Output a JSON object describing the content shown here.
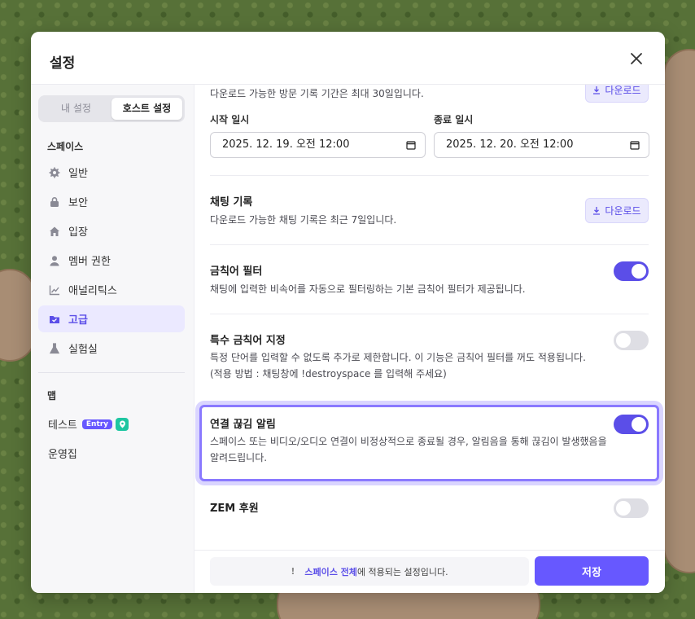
{
  "modal": {
    "title": "설정"
  },
  "sidebar": {
    "tabs": [
      {
        "label": "내 설정"
      },
      {
        "label": "호스트 설정"
      }
    ],
    "space_section": "스페이스",
    "items": [
      {
        "label": "일반",
        "icon": "gear-icon"
      },
      {
        "label": "보안",
        "icon": "lock-icon"
      },
      {
        "label": "입장",
        "icon": "home-icon"
      },
      {
        "label": "멤버 권한",
        "icon": "person-icon"
      },
      {
        "label": "애널리틱스",
        "icon": "chart-icon"
      },
      {
        "label": "고급",
        "icon": "folder-icon",
        "active": true
      },
      {
        "label": "실험실",
        "icon": "flask-icon"
      }
    ],
    "map_section": "맵",
    "maps": [
      {
        "label": "테스트",
        "badge": "Entry"
      },
      {
        "label": "운영집"
      }
    ]
  },
  "visit_log": {
    "desc": "다운로드 가능한 방문 기록 기간은 최대 30일입니다.",
    "download_label": "다운로드",
    "start_label": "시작 일시",
    "start_value": "2025. 12. 19. 오전 12:00",
    "end_label": "종료 일시",
    "end_value": "2025. 12. 20. 오전 12:00"
  },
  "chat_log": {
    "title": "채팅 기록",
    "desc": "다운로드 가능한 채팅 기록은 최근 7일입니다.",
    "download_label": "다운로드"
  },
  "settings": [
    {
      "title": "금칙어 필터",
      "desc": [
        "채팅에 입력한 비속어를 자동으로 필터링하는 기본 금칙어 필터가 제공됩니다."
      ],
      "enabled": true
    },
    {
      "title": "특수 금칙어 지정",
      "desc": [
        "특정 단어를 입력할 수 없도록 추가로 제한합니다. 이 기능은 금칙어 필터를 꺼도 적용됩니다.",
        "(적용 방법 : 채팅창에 !destroyspace 를 입력해 주세요)"
      ],
      "enabled": false
    },
    {
      "title": "연결 끊김 알림",
      "desc": [
        "스페이스 또는 비디오/오디오 연결이 비정상적으로 종료될 경우, 알림음을 통해 끊김이 발생했음을",
        "알려드립니다."
      ],
      "enabled": true
    },
    {
      "title": "ZEM 후원",
      "desc": [],
      "enabled": false
    }
  ],
  "footer": {
    "notice_bang": "!",
    "notice_accent": "스페이스 전체",
    "notice_rest": "에 적용되는 설정입니다.",
    "save_label": "저장"
  },
  "colors": {
    "accent": "#5b4ee8",
    "button": "#6758ff",
    "highlight": "#8a79ff"
  }
}
